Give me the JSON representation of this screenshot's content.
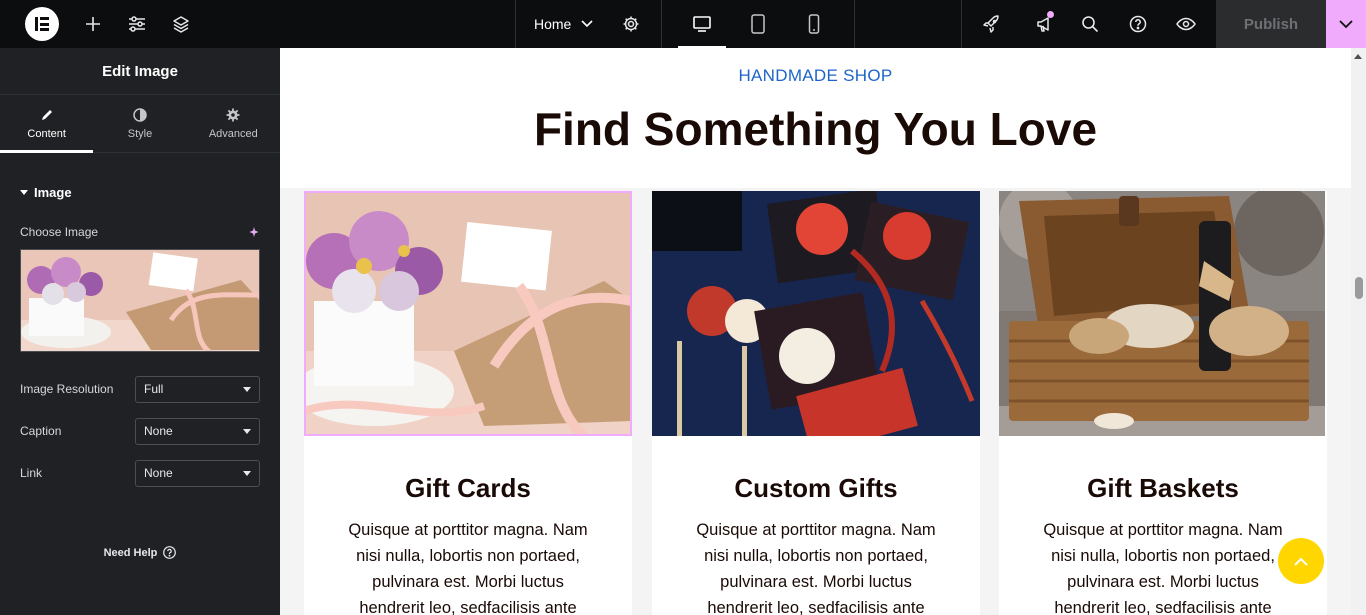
{
  "topbar": {
    "page_name": "Home",
    "publish_label": "Publish",
    "icons": [
      "elementor-logo-icon",
      "plus-icon",
      "sliders-icon",
      "layers-icon",
      "chevron-down-icon",
      "gear-icon",
      "desktop-icon",
      "tablet-icon",
      "mobile-icon",
      "rocket-icon",
      "megaphone-icon",
      "search-icon",
      "help-icon",
      "eye-icon"
    ]
  },
  "panel": {
    "title": "Edit Image",
    "tabs": [
      {
        "label": "Content",
        "icon": "pencil-icon"
      },
      {
        "label": "Style",
        "icon": "contrast-icon"
      },
      {
        "label": "Advanced",
        "icon": "gear-icon"
      }
    ],
    "section": "Image",
    "choose_image_label": "Choose Image",
    "fields": [
      {
        "label": "Image Resolution",
        "value": "Full"
      },
      {
        "label": "Caption",
        "value": "None"
      },
      {
        "label": "Link",
        "value": "None"
      }
    ],
    "need_help": "Need Help"
  },
  "page": {
    "eyebrow": "HANDMADE SHOP",
    "headline": "Find Something You Love",
    "cards": [
      {
        "title": "Gift Cards",
        "text": "Quisque at porttitor magna. Nam nisi nulla, lobortis non portaed, pulvinara est. Morbi luctus hendrerit leo, sedfacilisis ante"
      },
      {
        "title": "Custom Gifts",
        "text": "Quisque at porttitor magna. Nam nisi nulla, lobortis non portaed, pulvinara est. Morbi luctus hendrerit leo, sedfacilisis ante"
      },
      {
        "title": "Gift Baskets",
        "text": "Quisque at porttitor magna. Nam nisi nulla, lobortis non portaed, pulvinara est. Morbi luctus hendrerit leo, sedfacilisis ante"
      }
    ]
  },
  "colors": {
    "accent": "#f0abfc",
    "eyebrow": "#1e64c8",
    "back_to_top": "#ffd600",
    "panel_bg": "#1f2124",
    "topbar_bg": "#0c0d0e"
  }
}
